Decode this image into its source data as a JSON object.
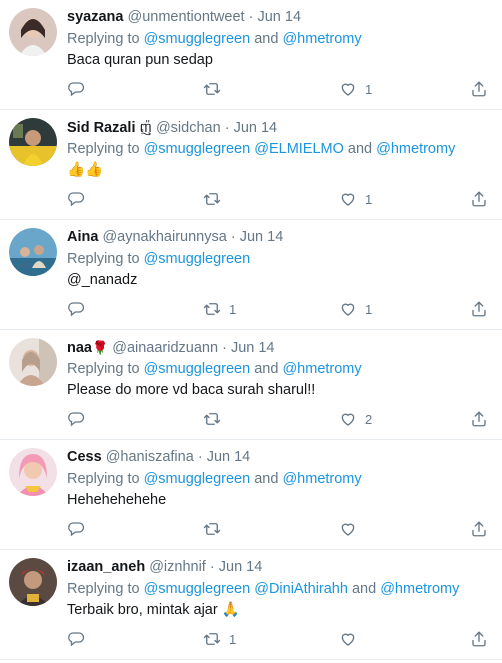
{
  "tweets": [
    {
      "name": "syazana",
      "name_emoji": "",
      "handle": "@unmentiontweet",
      "date": "Jun 14",
      "replying_prefix": "Replying to ",
      "replying_a": "@smugglegreen",
      "replying_mid": " and ",
      "replying_b": "@hmetromy",
      "replying_tail": "",
      "body": "Baca quran pun sedap",
      "retweets": "",
      "likes": "1"
    },
    {
      "name": "Sid Razali",
      "name_emoji": "ញ៉",
      "handle": "@sidchan",
      "date": "Jun 14",
      "replying_prefix": "Replying to ",
      "replying_a": "@smugglegreen",
      "replying_mid": " ",
      "replying_b": "@ELMIELMO",
      "replying_mid2": " and ",
      "replying_c": "@hmetromy",
      "body": "👍👍",
      "retweets": "",
      "likes": "1"
    },
    {
      "name": "Aina",
      "name_emoji": "",
      "handle": "@aynakhairunnysa",
      "date": "Jun 14",
      "replying_prefix": "Replying to ",
      "replying_a": "@smugglegreen",
      "body_link": "@_nanadz",
      "retweets": "1",
      "likes": "1"
    },
    {
      "name": "naa",
      "name_emoji": "🌹",
      "handle": "@ainaaridzuann",
      "date": "Jun 14",
      "replying_prefix": "Replying to ",
      "replying_a": "@smugglegreen",
      "replying_mid": " and ",
      "replying_b": "@hmetromy",
      "body": "Please do more vd baca surah sharul!!",
      "retweets": "",
      "likes": "2"
    },
    {
      "name": "Cess",
      "name_emoji": "",
      "handle": "@haniszafina",
      "date": "Jun 14",
      "replying_prefix": "Replying to ",
      "replying_a": "@smugglegreen",
      "replying_mid": " and ",
      "replying_b": "@hmetromy",
      "body": "Hehehehehehe",
      "retweets": "",
      "likes": ""
    },
    {
      "name": "izaan_aneh",
      "name_emoji": "",
      "handle": "@iznhnif",
      "date": "Jun 14",
      "replying_prefix": "Replying to ",
      "replying_a": "@smugglegreen",
      "replying_mid": " ",
      "replying_b": "@DiniAthirahh",
      "replying_mid2": " and ",
      "replying_c": "@hmetromy",
      "body": "Terbaik bro, mintak ajar 🙏",
      "retweets": "1",
      "likes": ""
    }
  ],
  "separator": "·",
  "icons": {
    "reply": "reply-icon",
    "retweet": "retweet-icon",
    "like": "heart-icon",
    "share": "share-icon"
  },
  "colors": {
    "link": "#1b95e0",
    "muted": "#657786",
    "text": "#14171a",
    "divider": "#e6ecf0"
  }
}
